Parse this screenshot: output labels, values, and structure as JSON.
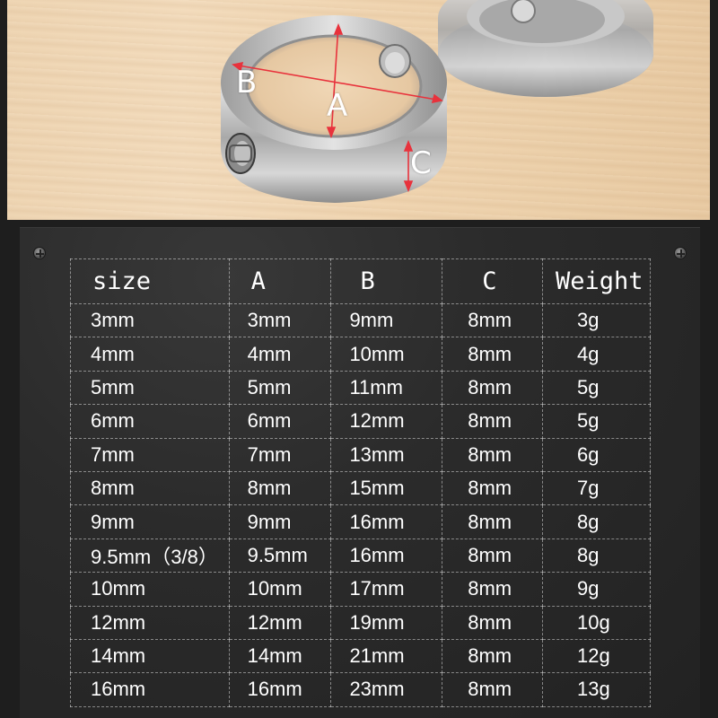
{
  "labels": {
    "b": "B",
    "a": "A",
    "c": "C"
  },
  "table": {
    "headers": [
      "size",
      "A",
      "B",
      "C",
      "Weight"
    ],
    "rows": [
      [
        "3mm",
        "3mm",
        "9mm",
        "8mm",
        "3g"
      ],
      [
        "4mm",
        "4mm",
        "10mm",
        "8mm",
        "4g"
      ],
      [
        "5mm",
        "5mm",
        "11mm",
        "8mm",
        "5g"
      ],
      [
        "6mm",
        "6mm",
        "12mm",
        "8mm",
        "5g"
      ],
      [
        "7mm",
        "7mm",
        "13mm",
        "8mm",
        "6g"
      ],
      [
        "8mm",
        "8mm",
        "15mm",
        "8mm",
        "7g"
      ],
      [
        "9mm",
        "9mm",
        "16mm",
        "8mm",
        "8g"
      ],
      [
        "9.5mm（3/8）",
        "9.5mm",
        "16mm",
        "8mm",
        "8g"
      ],
      [
        "10mm",
        "10mm",
        "17mm",
        "8mm",
        "9g"
      ],
      [
        "12mm",
        "12mm",
        "19mm",
        "8mm",
        "10g"
      ],
      [
        "14mm",
        "14mm",
        "21mm",
        "8mm",
        "12g"
      ],
      [
        "16mm",
        "16mm",
        "23mm",
        "8mm",
        "13g"
      ]
    ]
  },
  "colors": {
    "dimension_line": "#e8323c",
    "label": "#ffffff",
    "panel": "#2b2b2b"
  }
}
